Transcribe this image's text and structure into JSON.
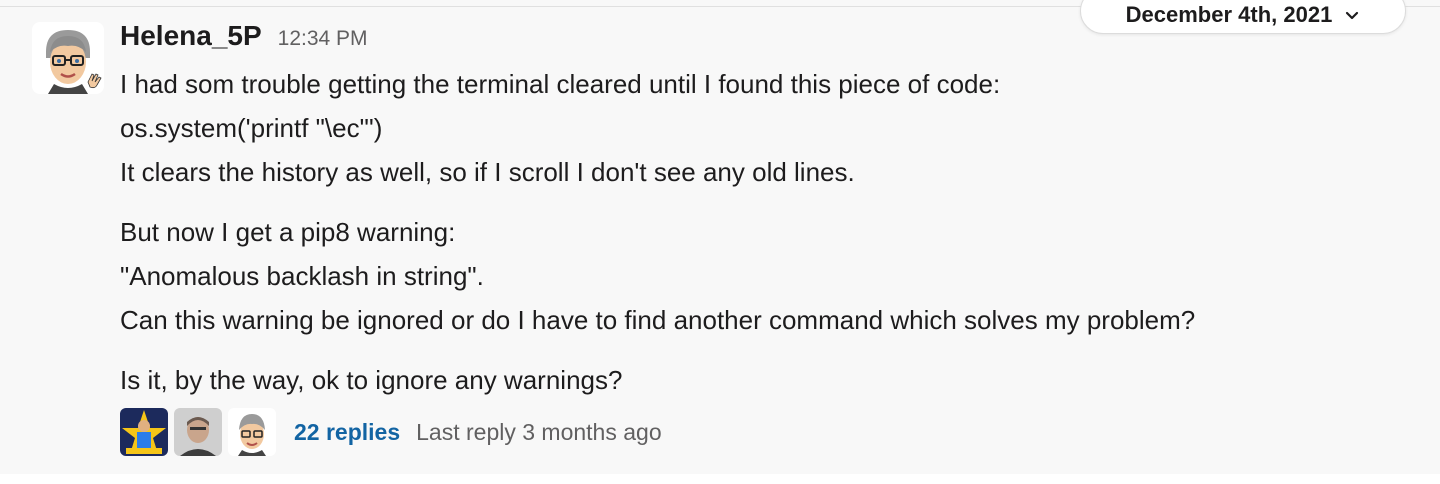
{
  "date_divider": {
    "label": "December 4th, 2021",
    "icon": "chevron-down-icon"
  },
  "message": {
    "author": "Helena_5P",
    "timestamp": "12:34 PM",
    "lines": [
      "I had som trouble getting the terminal cleared until I found this piece of code:",
      "os.system('printf \"\\ec\"')",
      "It clears the history as well, so if I scroll I don't see any old lines.",
      "But now I get a pip8 warning:",
      "\"Anomalous backlash in string\".",
      "Can this warning be ignored or do I have to find another command which solves my problem?",
      "Is it, by the way, ok to ignore any warnings?"
    ]
  },
  "thread": {
    "replies_label": "22 replies",
    "last_reply": "Last reply 3 months ago",
    "participants": [
      "superhero-avatar",
      "photo-avatar",
      "cartoon-avatar"
    ]
  },
  "colors": {
    "link": "#1264a3",
    "muted": "#616061",
    "text": "#1d1c1d",
    "message_bg": "#f8f8f8"
  }
}
